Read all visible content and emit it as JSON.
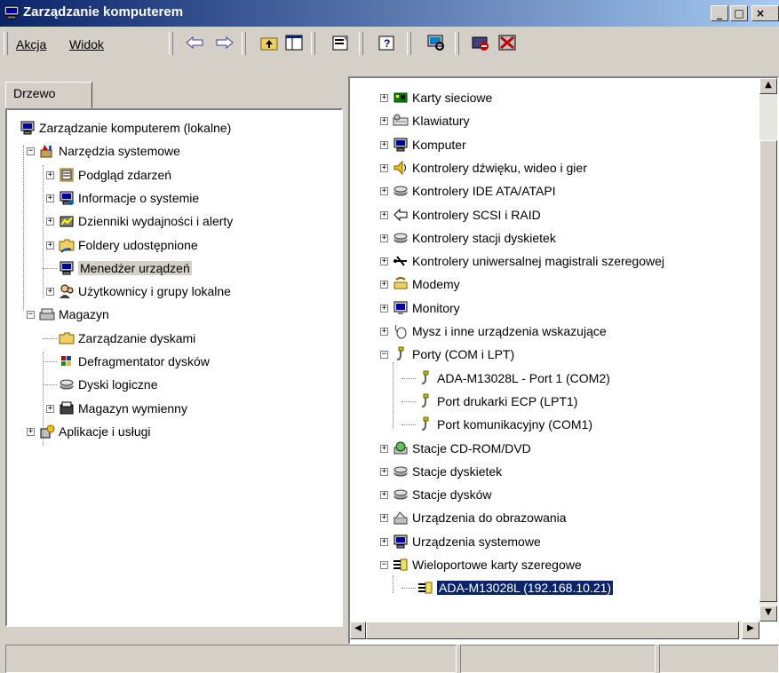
{
  "window": {
    "title": "Zarządzanie komputerem",
    "buttons": {
      "minimize": "_",
      "maximize": "□",
      "close": "×"
    }
  },
  "menu": {
    "action": "Akcja",
    "view": "Widok"
  },
  "left_pane": {
    "tab_label": "Drzewo",
    "tree": [
      {
        "label": "Zarządzanie komputerem (lokalne)",
        "icon": "computer-management-icon",
        "level": 0,
        "expander": ""
      },
      {
        "label": "Narzędzia systemowe",
        "icon": "system-tools-icon",
        "level": 1,
        "expander": "−"
      },
      {
        "label": "Podgląd zdarzeń",
        "icon": "event-viewer-icon",
        "level": 2,
        "expander": "+"
      },
      {
        "label": "Informacje o systemie",
        "icon": "system-info-icon",
        "level": 2,
        "expander": "+"
      },
      {
        "label": "Dzienniki wydajności i alerty",
        "icon": "performance-logs-icon",
        "level": 2,
        "expander": "+"
      },
      {
        "label": "Foldery udostępnione",
        "icon": "shared-folders-icon",
        "level": 2,
        "expander": "+"
      },
      {
        "label": "Menedżer urządzeń",
        "icon": "device-manager-icon",
        "level": 2,
        "expander": "",
        "state": "highlighted"
      },
      {
        "label": "Użytkownicy i grupy lokalne",
        "icon": "users-groups-icon",
        "level": 2,
        "expander": "+"
      },
      {
        "label": "Magazyn",
        "icon": "storage-icon",
        "level": 1,
        "expander": "−"
      },
      {
        "label": "Zarządzanie dyskami",
        "icon": "disk-management-icon",
        "level": 2,
        "expander": ""
      },
      {
        "label": "Defragmentator dysków",
        "icon": "defragmenter-icon",
        "level": 2,
        "expander": ""
      },
      {
        "label": "Dyski logiczne",
        "icon": "logical-drives-icon",
        "level": 2,
        "expander": ""
      },
      {
        "label": "Magazyn wymienny",
        "icon": "removable-storage-icon",
        "level": 2,
        "expander": "+"
      },
      {
        "label": "Aplikacje i usługi",
        "icon": "services-apps-icon",
        "level": 1,
        "expander": "+"
      }
    ]
  },
  "right_pane": {
    "tree": [
      {
        "label": "Karty sieciowe",
        "icon": "network-adapter-icon",
        "level": 0,
        "expander": "+"
      },
      {
        "label": "Klawiatury",
        "icon": "keyboard-icon",
        "level": 0,
        "expander": "+"
      },
      {
        "label": "Komputer",
        "icon": "computer-icon",
        "level": 0,
        "expander": "+"
      },
      {
        "label": "Kontrolery dźwięku, wideo i gier",
        "icon": "sound-icon",
        "level": 0,
        "expander": "+"
      },
      {
        "label": "Kontrolery IDE ATA/ATAPI",
        "icon": "ide-icon",
        "level": 0,
        "expander": "+"
      },
      {
        "label": "Kontrolery SCSI i RAID",
        "icon": "scsi-icon",
        "level": 0,
        "expander": "+"
      },
      {
        "label": "Kontrolery stacji dyskietek",
        "icon": "floppy-controller-icon",
        "level": 0,
        "expander": "+"
      },
      {
        "label": "Kontrolery uniwersalnej magistrali szeregowej",
        "icon": "usb-icon",
        "level": 0,
        "expander": "+"
      },
      {
        "label": "Modemy",
        "icon": "modem-icon",
        "level": 0,
        "expander": "+"
      },
      {
        "label": "Monitory",
        "icon": "monitor-icon",
        "level": 0,
        "expander": "+"
      },
      {
        "label": "Mysz i inne urządzenia wskazujące",
        "icon": "mouse-icon",
        "level": 0,
        "expander": "+"
      },
      {
        "label": "Porty (COM i LPT)",
        "icon": "port-icon",
        "level": 0,
        "expander": "−"
      },
      {
        "label": "ADA-M13028L - Port 1 (COM2)",
        "icon": "port-icon",
        "level": 1,
        "expander": ""
      },
      {
        "label": "Port drukarki ECP (LPT1)",
        "icon": "port-icon",
        "level": 1,
        "expander": ""
      },
      {
        "label": "Port komunikacyjny (COM1)",
        "icon": "port-icon",
        "level": 1,
        "expander": ""
      },
      {
        "label": "Stacje CD-ROM/DVD",
        "icon": "cdrom-icon",
        "level": 0,
        "expander": "+"
      },
      {
        "label": "Stacje dyskietek",
        "icon": "floppy-icon",
        "level": 0,
        "expander": "+"
      },
      {
        "label": "Stacje dysków",
        "icon": "disk-drive-icon",
        "level": 0,
        "expander": "+"
      },
      {
        "label": "Urządzenia do obrazowania",
        "icon": "imaging-icon",
        "level": 0,
        "expander": "+"
      },
      {
        "label": "Urządzenia systemowe",
        "icon": "system-devices-icon",
        "level": 0,
        "expander": "+"
      },
      {
        "label": "Wieloportowe karty szeregowe",
        "icon": "multiport-serial-icon",
        "level": 0,
        "expander": "−"
      },
      {
        "label": "ADA-M13028L (192.168.10.21)",
        "icon": "multiport-serial-icon",
        "level": 1,
        "expander": "",
        "state": "selected"
      }
    ]
  },
  "colors": {
    "title_start": "#0a246a",
    "title_end": "#a6caf0",
    "face": "#d4d0c8",
    "selection": "#0a246a"
  }
}
